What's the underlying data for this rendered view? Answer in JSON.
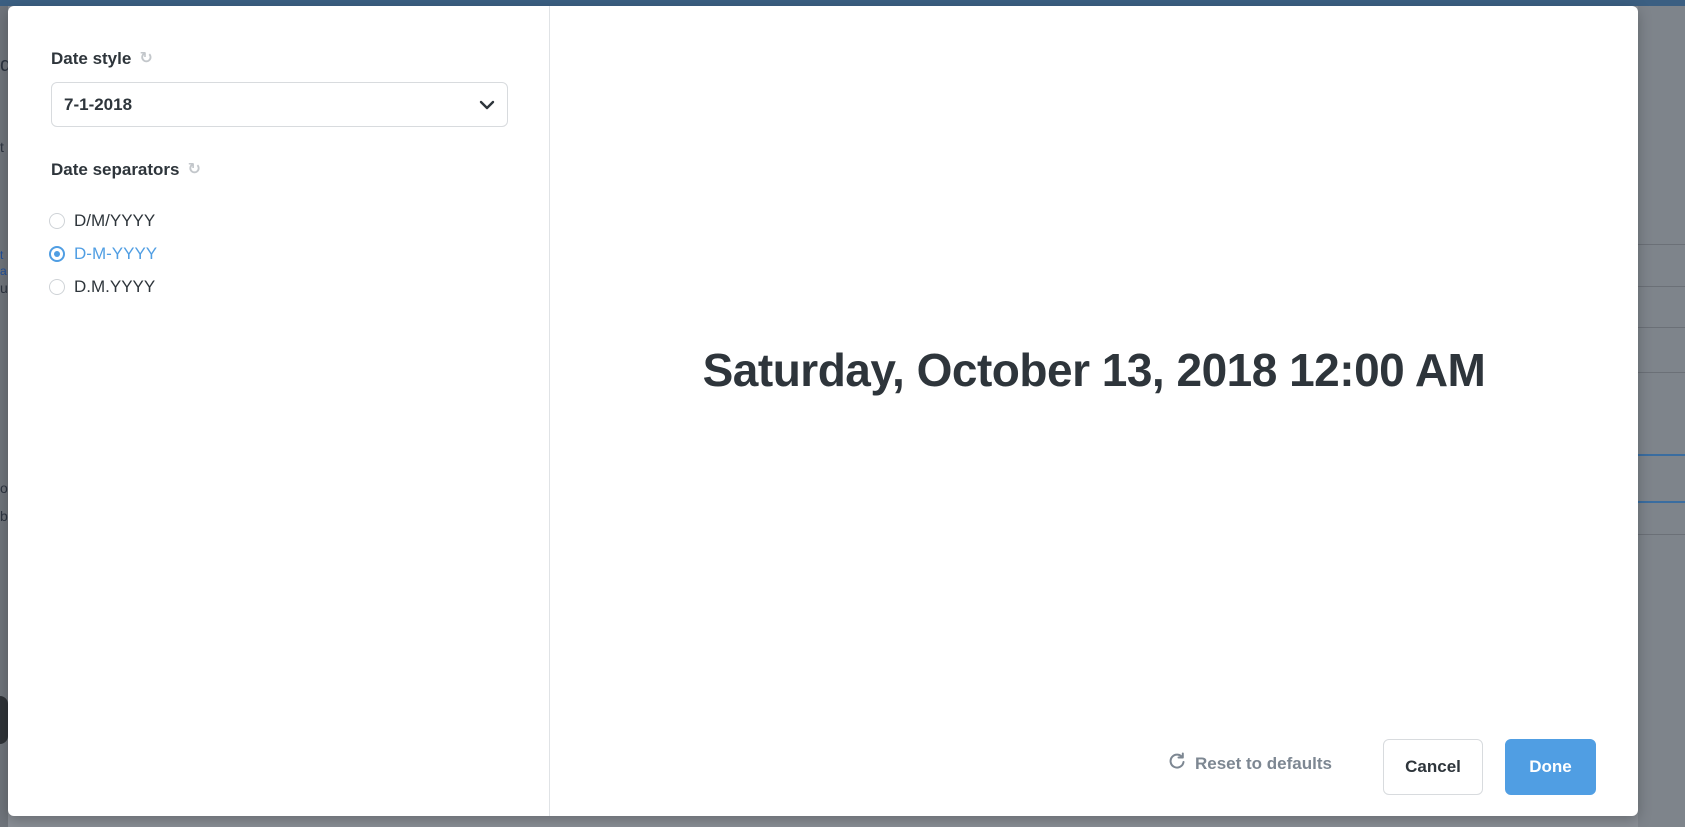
{
  "sidebar": {
    "date_style": {
      "label": "Date style",
      "selected_value": "7-1-2018"
    },
    "date_separators": {
      "label": "Date separators",
      "options": [
        {
          "label": "D/M/YYYY",
          "checked": false
        },
        {
          "label": "D-M-YYYY",
          "checked": true
        },
        {
          "label": "D.M.YYYY",
          "checked": false
        }
      ]
    }
  },
  "preview": {
    "text": "Saturday, October 13, 2018 12:00 AM"
  },
  "footer": {
    "reset_label": "Reset to defaults",
    "cancel_label": "Cancel",
    "done_label": "Done"
  },
  "colors": {
    "accent": "#509ee3",
    "text": "#2e353b",
    "muted": "#7d8792"
  },
  "background_fragments": [
    "q",
    "t",
    "t",
    "a",
    "u",
    "o",
    "b"
  ]
}
